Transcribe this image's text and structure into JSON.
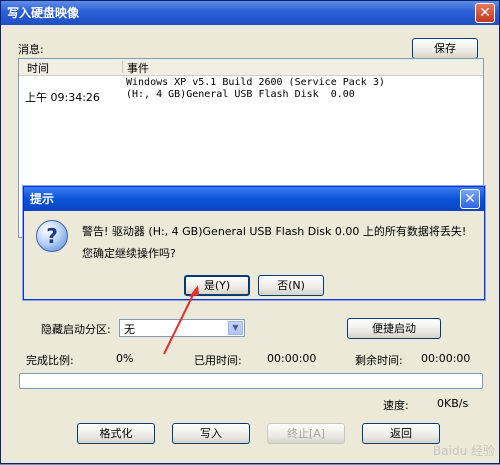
{
  "window": {
    "title": "写入硬盘映像",
    "close_glyph": "✕"
  },
  "messages": {
    "label": "消息:",
    "save_label": "保存",
    "columns": [
      "时间",
      "事件"
    ],
    "rows": [
      {
        "time": "",
        "event": "Windows XP v5.1 Build 2600 (Service Pack 3)"
      },
      {
        "time": "上午 09:34:26",
        "event": "(H:, 4 GB)General USB Flash Disk  0.00"
      }
    ]
  },
  "hidden_partition": {
    "label": "隐藏启动分区:",
    "selected": "无",
    "quick_boot_label": "便捷启动"
  },
  "status": {
    "progress_label": "完成比例:",
    "progress_value": "0%",
    "elapsed_label": "已用时间:",
    "elapsed_value": "00:00:00",
    "remaining_label": "剩余时间:",
    "remaining_value": "00:00:00",
    "speed_label": "速度:",
    "speed_value": "0KB/s",
    "progress_fraction": 0
  },
  "buttons": {
    "format": "格式化",
    "write": "写入",
    "stop": "终止[A]",
    "back": "返回"
  },
  "dialog": {
    "title": "提示",
    "line1": "警告! 驱动器 (H:, 4 GB)General USB Flash Disk  0.00 上的所有数据将丢失!",
    "line2": "您确定继续操作吗?",
    "yes_label": "是(Y)",
    "no_label": "否(N)",
    "icon_glyph": "?"
  },
  "colors": {
    "accent": "#0a53d8",
    "annotation_arrow": "#e0322e"
  }
}
